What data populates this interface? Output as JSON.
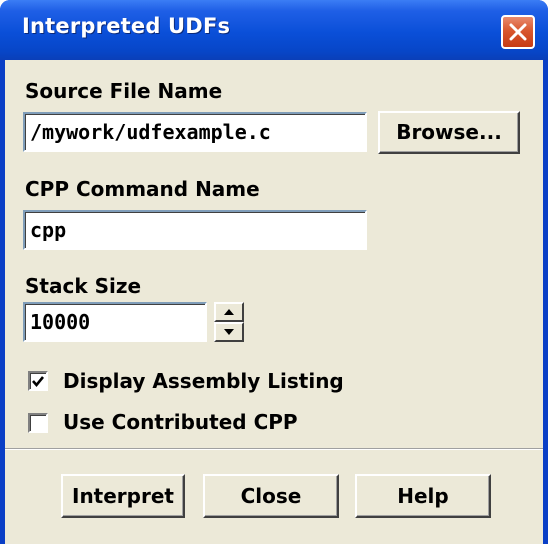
{
  "window": {
    "title": "Interpreted UDFs",
    "close_icon": "close-icon"
  },
  "source_file": {
    "label": "Source File Name",
    "value": "/mywork/udfexample.c",
    "browse_label": "Browse..."
  },
  "cpp_command": {
    "label": "CPP Command Name",
    "value": "cpp"
  },
  "stack_size": {
    "label": "Stack Size",
    "value": "10000"
  },
  "options": {
    "display_assembly": {
      "label": "Display Assembly Listing",
      "checked": true
    },
    "use_contributed_cpp": {
      "label": "Use Contributed CPP",
      "checked": false
    }
  },
  "buttons": {
    "interpret": "Interpret",
    "close": "Close",
    "help": "Help"
  },
  "colors": {
    "titlebar": "#0a4fd8",
    "client": "#ece9d8",
    "close_button": "#d9582f"
  }
}
